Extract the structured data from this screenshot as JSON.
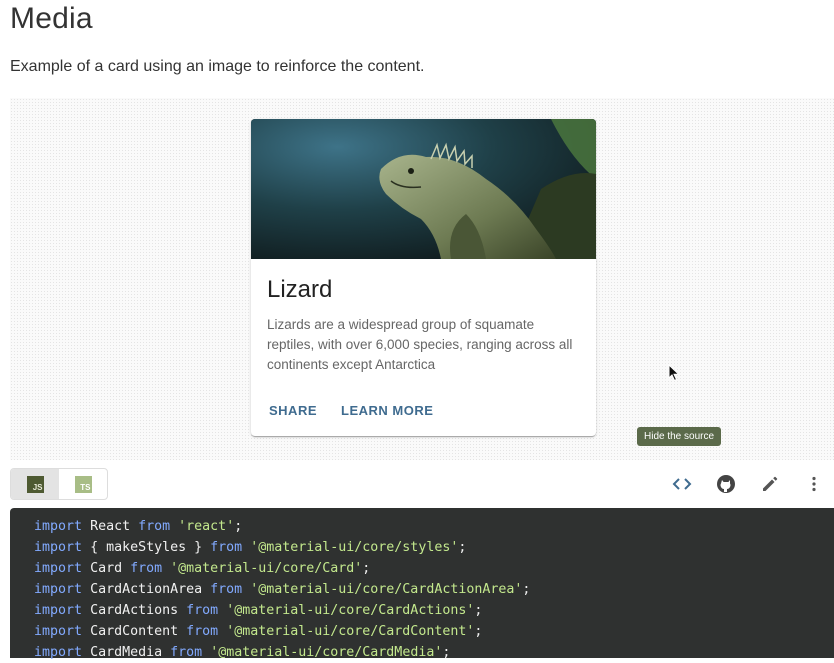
{
  "page": {
    "title": "Media",
    "description": "Example of a card using an image to reinforce the content."
  },
  "card": {
    "image_alt": "Lizard",
    "title": "Lizard",
    "body": "Lizards are a widespread group of squamate reptiles, with over 6,000 species, ranging across all continents except Antarctica",
    "actions": {
      "share": "SHARE",
      "learn_more": "LEARN MORE"
    }
  },
  "tooltip": "Hide the source",
  "toolbar": {
    "js_label": "JS",
    "ts_label": "TS",
    "icons": [
      "code-icon",
      "github-icon",
      "edit-icon",
      "more-vert-icon"
    ]
  },
  "code": {
    "lines": [
      {
        "kw": "import",
        "name": "React",
        "from": "from",
        "str": "'react'"
      },
      {
        "kw": "import",
        "name": "{ makeStyles }",
        "from": "from",
        "str": "'@material-ui/core/styles'"
      },
      {
        "kw": "import",
        "name": "Card",
        "from": "from",
        "str": "'@material-ui/core/Card'"
      },
      {
        "kw": "import",
        "name": "CardActionArea",
        "from": "from",
        "str": "'@material-ui/core/CardActionArea'"
      },
      {
        "kw": "import",
        "name": "CardActions",
        "from": "from",
        "str": "'@material-ui/core/CardActions'"
      },
      {
        "kw": "import",
        "name": "CardContent",
        "from": "from",
        "str": "'@material-ui/core/CardContent'"
      },
      {
        "kw": "import",
        "name": "CardMedia",
        "from": "from",
        "str": "'@material-ui/core/CardMedia'"
      }
    ]
  },
  "colors": {
    "primary_text_button": "#3f6b8f",
    "code_background": "#2f3130",
    "tooltip_background": "#5b6a4a"
  }
}
